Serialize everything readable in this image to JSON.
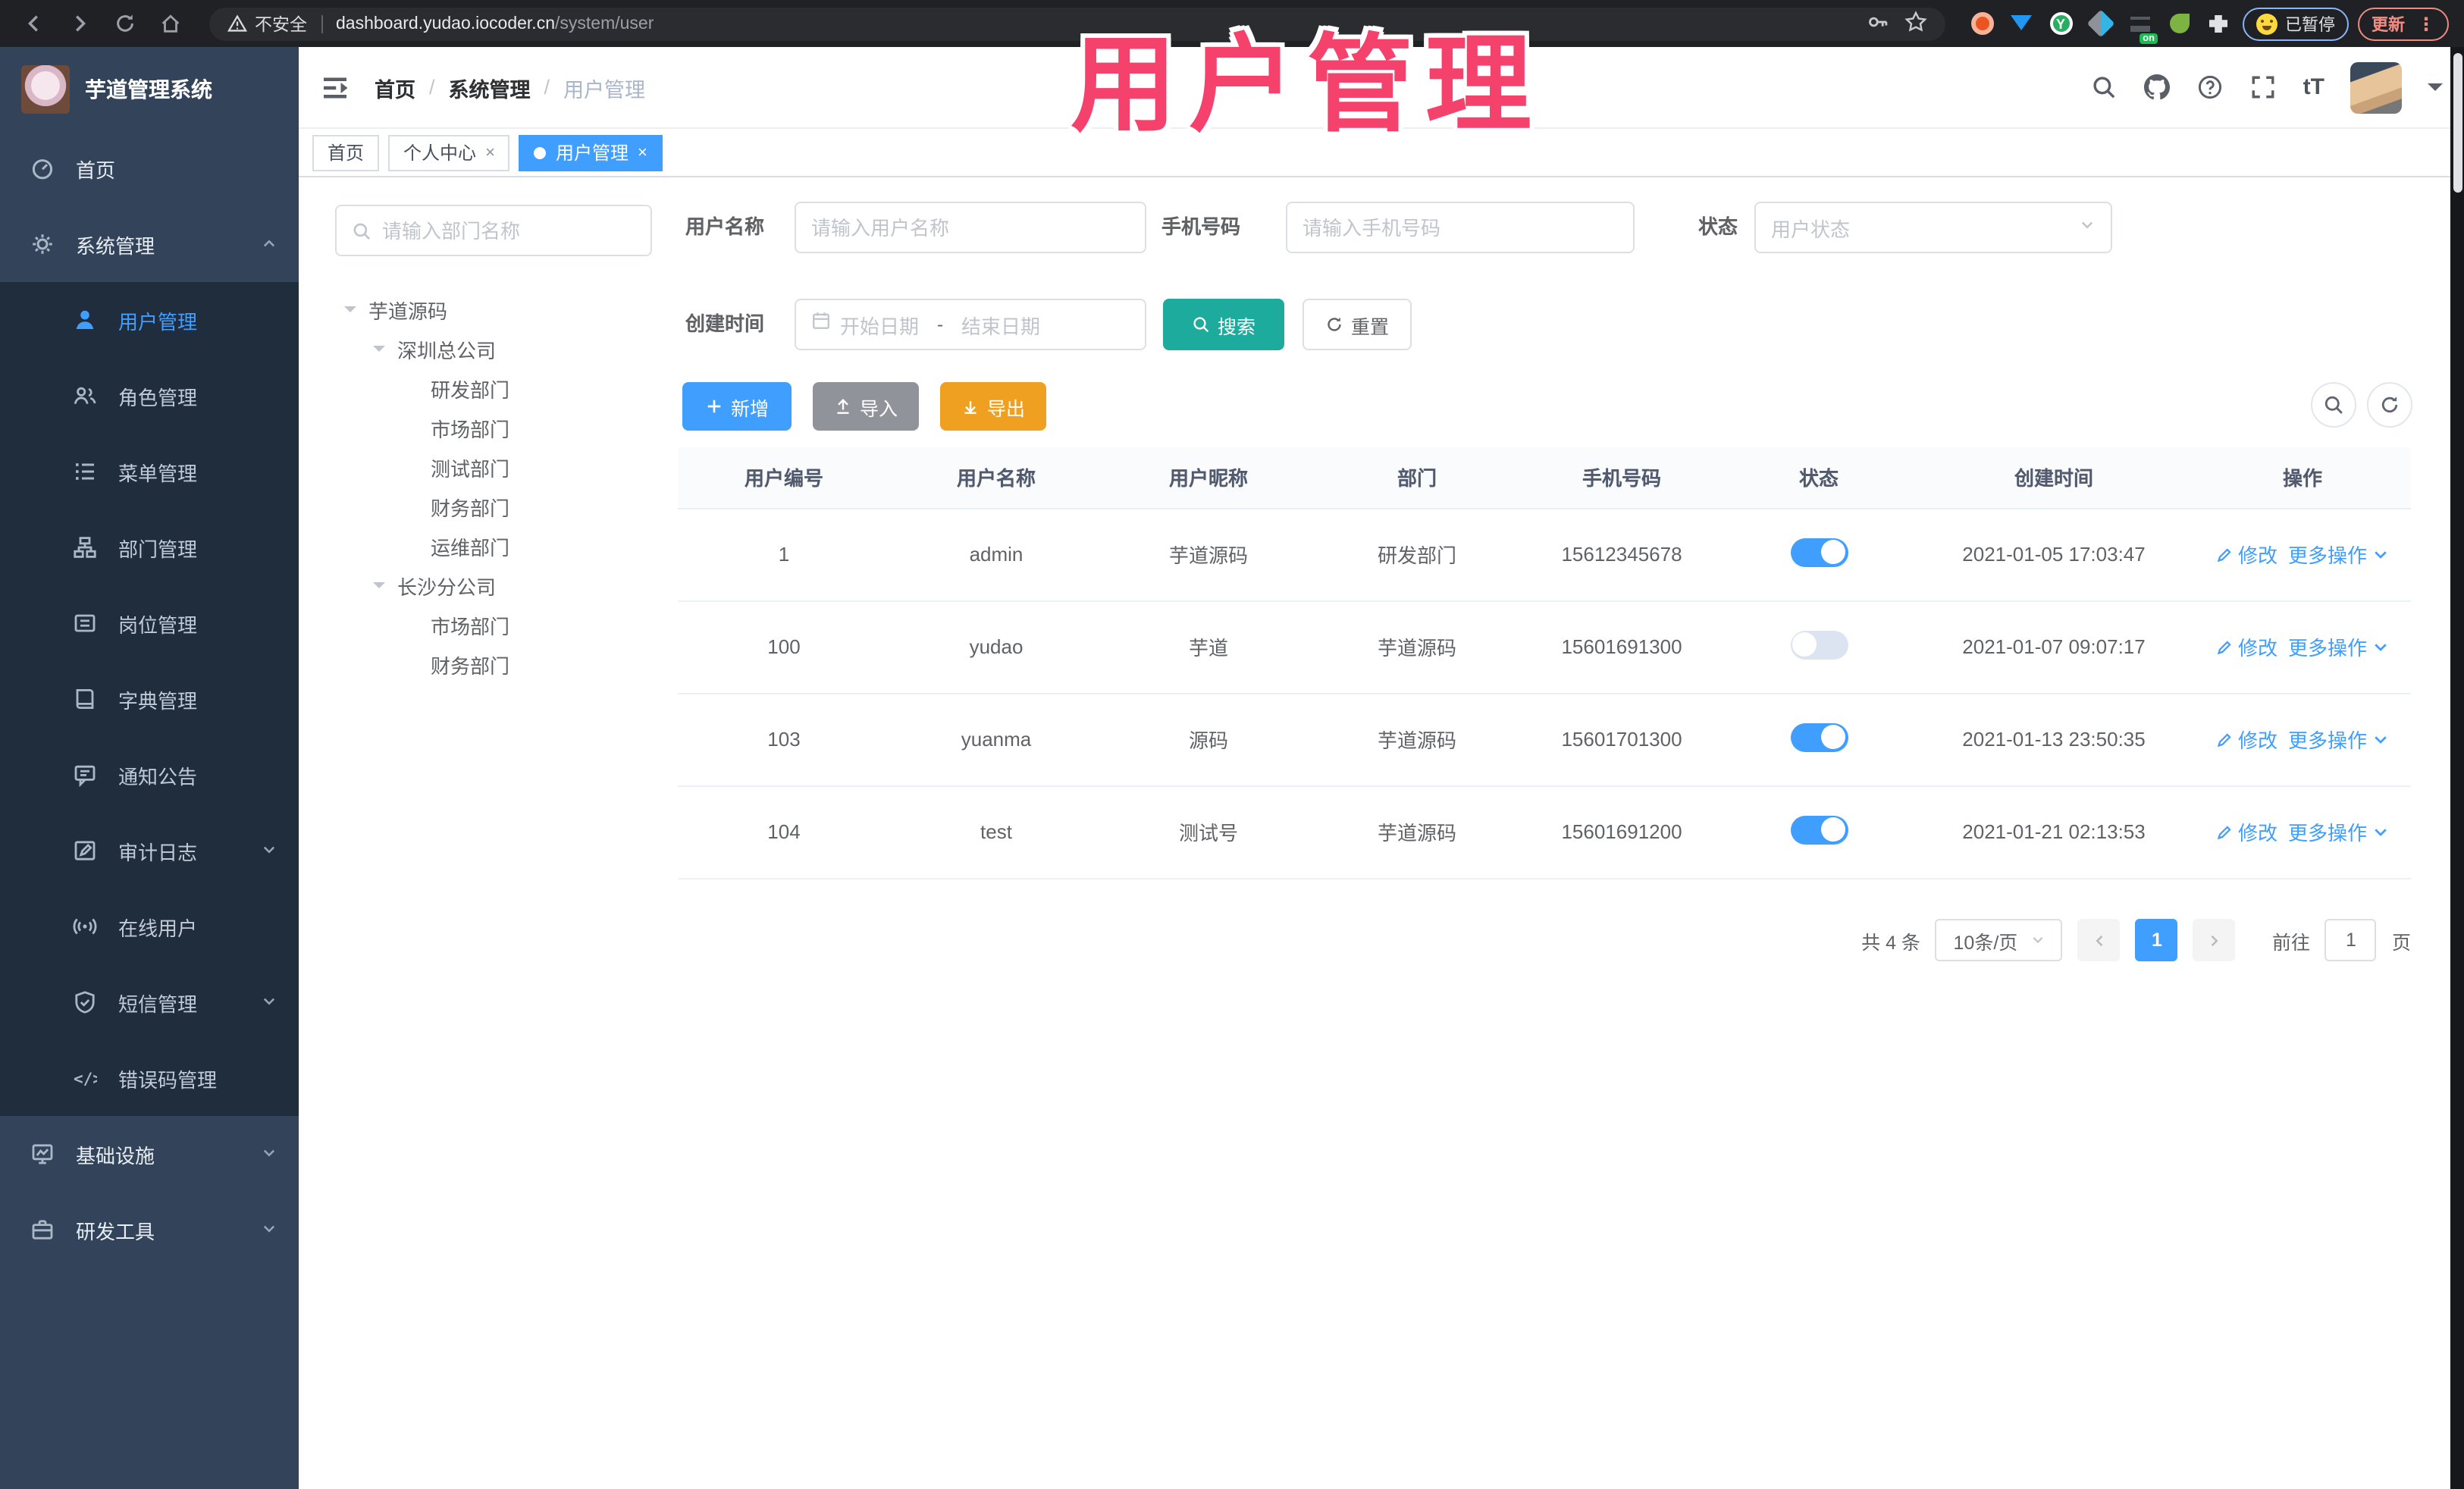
{
  "browser": {
    "security_label": "不安全",
    "url_host": "dashboard.yudao.iocoder.cn",
    "url_path": "/system/user",
    "paused_badge_label": "已暂停",
    "update_label": "更新"
  },
  "overlay_title": "用户管理",
  "colors": {
    "accent": "#409eff",
    "search_teal": "#1cab9c",
    "export_orange": "#f0a020",
    "import_gray": "#909399",
    "overlay_pink": "#f4426d",
    "sidebar_bg": "#33445a",
    "submenu_bg": "#1f2d3d"
  },
  "sidebar": {
    "logo_title": "芋道管理系统",
    "items": {
      "home": {
        "label": "首页",
        "icon": "dashboard-icon"
      },
      "system": {
        "label": "系统管理",
        "icon": "gear-icon",
        "state": "expanded"
      },
      "infra": {
        "label": "基础设施",
        "icon": "infra-icon",
        "state": "collapsed"
      },
      "devtools": {
        "label": "研发工具",
        "icon": "tools-icon",
        "state": "collapsed"
      }
    },
    "submenu": [
      {
        "label": "用户管理",
        "icon": "user-icon",
        "active": true
      },
      {
        "label": "角色管理",
        "icon": "roles-icon"
      },
      {
        "label": "菜单管理",
        "icon": "menu-icon"
      },
      {
        "label": "部门管理",
        "icon": "dept-icon"
      },
      {
        "label": "岗位管理",
        "icon": "post-icon"
      },
      {
        "label": "字典管理",
        "icon": "dict-icon"
      },
      {
        "label": "通知公告",
        "icon": "notice-icon"
      },
      {
        "label": "审计日志",
        "icon": "audit-icon",
        "state": "collapsed"
      },
      {
        "label": "在线用户",
        "icon": "online-icon"
      },
      {
        "label": "短信管理",
        "icon": "sms-icon",
        "state": "collapsed"
      },
      {
        "label": "错误码管理",
        "icon": "error-code-icon"
      }
    ]
  },
  "header": {
    "breadcrumb": [
      "首页",
      "系统管理",
      "用户管理"
    ],
    "separator": "/",
    "font_size_tool": "tT"
  },
  "tabs": [
    {
      "label": "首页"
    },
    {
      "label": "个人中心",
      "close": "×"
    },
    {
      "label": "用户管理",
      "close": "×",
      "active": true
    }
  ],
  "dept_panel": {
    "search_placeholder": "请输入部门名称",
    "tree": [
      {
        "label": "芋道源码",
        "depth": 0,
        "expandable": true
      },
      {
        "label": "深圳总公司",
        "depth": 1,
        "expandable": true
      },
      {
        "label": "研发部门",
        "depth": 2
      },
      {
        "label": "市场部门",
        "depth": 2
      },
      {
        "label": "测试部门",
        "depth": 2
      },
      {
        "label": "财务部门",
        "depth": 2
      },
      {
        "label": "运维部门",
        "depth": 2
      },
      {
        "label": "长沙分公司",
        "depth": 1,
        "expandable": true
      },
      {
        "label": "市场部门",
        "depth": 2
      },
      {
        "label": "财务部门",
        "depth": 2
      }
    ]
  },
  "filters": {
    "username_label": "用户名称",
    "username_placeholder": "请输入用户名称",
    "mobile_label": "手机号码",
    "mobile_placeholder": "请输入手机号码",
    "status_label": "状态",
    "status_placeholder": "用户状态",
    "createtime_label": "创建时间",
    "date_start_placeholder": "开始日期",
    "date_separator": "-",
    "date_end_placeholder": "结束日期",
    "search_label": "搜索",
    "reset_label": "重置"
  },
  "toolbar": {
    "add_label": "新增",
    "import_label": "导入",
    "export_label": "导出"
  },
  "table": {
    "headers": [
      "用户编号",
      "用户名称",
      "用户昵称",
      "部门",
      "手机号码",
      "状态",
      "创建时间",
      "操作"
    ],
    "action_edit": "修改",
    "action_more": "更多操作",
    "rows": [
      {
        "id": "1",
        "username": "admin",
        "nickname": "芋道源码",
        "dept": "研发部门",
        "mobile": "15612345678",
        "status_on": true,
        "create_time": "2021-01-05 17:03:47"
      },
      {
        "id": "100",
        "username": "yudao",
        "nickname": "芋道",
        "dept": "芋道源码",
        "mobile": "15601691300",
        "status_on": false,
        "create_time": "2021-01-07 09:07:17"
      },
      {
        "id": "103",
        "username": "yuanma",
        "nickname": "源码",
        "dept": "芋道源码",
        "mobile": "15601701300",
        "status_on": true,
        "create_time": "2021-01-13 23:50:35"
      },
      {
        "id": "104",
        "username": "test",
        "nickname": "测试号",
        "dept": "芋道源码",
        "mobile": "15601691200",
        "status_on": true,
        "create_time": "2021-01-21 02:13:53"
      }
    ]
  },
  "pagination": {
    "total_text": "共 4 条",
    "page_size_text": "10条/页",
    "current_page": "1",
    "goto_label": "前往",
    "goto_value": "1",
    "page_unit": "页"
  }
}
